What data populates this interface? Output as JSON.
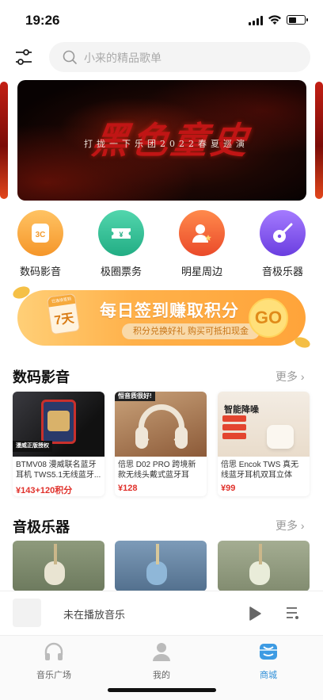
{
  "status_bar": {
    "time": "19:26"
  },
  "search": {
    "placeholder": "小来的精品歌单"
  },
  "banner": {
    "main_text": "黑色童史",
    "subtitle": "打拢一下乐团2022春夏巡演"
  },
  "categories": [
    {
      "label": "数码影音",
      "icon": "3c-icon",
      "color": "#f8a83d"
    },
    {
      "label": "极圈票务",
      "icon": "ticket-icon",
      "color": "#38c29a"
    },
    {
      "label": "明星周边",
      "icon": "star-person-icon",
      "color": "#f06a3f"
    },
    {
      "label": "音极乐器",
      "icon": "guitar-icon",
      "color": "#8a5bf0"
    }
  ],
  "sign_in": {
    "badge_top": "已连续签到",
    "badge_day": "7天",
    "title": "每日签到赚取积分",
    "subtitle": "积分兑换好礼 购买可抵扣现金",
    "go": "GO"
  },
  "sections": {
    "digital": {
      "title": "数码影音",
      "more": "更多"
    },
    "instruments": {
      "title": "音极乐器",
      "more": "更多"
    }
  },
  "products": [
    {
      "tag": "漫威正版授权",
      "name": "BTMV08 漫威联名蓝牙耳机 TWS5.1无线蓝牙...",
      "price": "¥143+120积分"
    },
    {
      "tag": "恒音质很好!",
      "name": "倍思 D02 PRO 跨境新款无线头戴式蓝牙耳机...",
      "price": "¥128"
    },
    {
      "tag": "智能降噪",
      "name": "倍思 Encok TWS 真无线蓝牙耳机双耳立体声...",
      "price": "¥99"
    }
  ],
  "player": {
    "status": "未在播放音乐"
  },
  "tabbar": {
    "tabs": [
      {
        "label": "音乐广场",
        "icon": "headphones-icon"
      },
      {
        "label": "我的",
        "icon": "person-icon"
      },
      {
        "label": "商城",
        "icon": "shop-icon"
      }
    ],
    "active_color": "#2f8fd8"
  }
}
